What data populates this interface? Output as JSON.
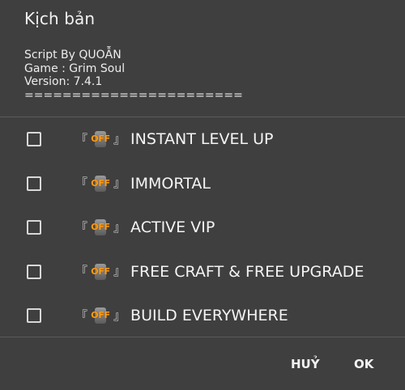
{
  "dialog": {
    "title": "Kịch bản",
    "description": [
      "Script By QUOẪN",
      "Game : Grim Soul",
      "Version: 7.4.1",
      "======================="
    ],
    "items": [
      {
        "label": "INSTANT LEVEL UP",
        "checked": false,
        "status": "OFF"
      },
      {
        "label": "IMMORTAL",
        "checked": false,
        "status": "OFF"
      },
      {
        "label": "ACTIVE VIP",
        "checked": false,
        "status": "OFF"
      },
      {
        "label": "FREE CRAFT & FREE UPGRADE",
        "checked": false,
        "status": "OFF"
      },
      {
        "label": "BUILD EVERYWHERE",
        "checked": false,
        "status": "OFF"
      }
    ],
    "bracket_open": "『",
    "bracket_close": "』",
    "cancel_label": "HUỶ",
    "ok_label": "OK"
  }
}
